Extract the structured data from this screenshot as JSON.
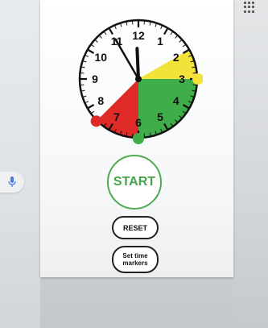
{
  "clock": {
    "numbers": [
      "12",
      "1",
      "2",
      "3",
      "4",
      "5",
      "6",
      "7",
      "8",
      "9",
      "10",
      "11"
    ],
    "hand_time": "11:55",
    "time_markers": [
      {
        "from": "2:00",
        "to": "3:00",
        "color": "#f2e23a",
        "name": "yellow"
      },
      {
        "from": "3:00",
        "to": "6:00",
        "color": "#3fae4a",
        "name": "green"
      },
      {
        "from": "6:00",
        "to": "7:30",
        "color": "#e02a28",
        "name": "red"
      }
    ]
  },
  "buttons": {
    "start_label": "START",
    "reset_label": "RESET",
    "markers_label": "Set time\nmarkers"
  },
  "colors": {
    "start_accent": "#46a24a",
    "yellow": "#f2e23a",
    "green": "#3fae4a",
    "red": "#e02a28"
  },
  "icons": {
    "apps": "apps-grid-icon",
    "mic": "microphone-icon"
  }
}
